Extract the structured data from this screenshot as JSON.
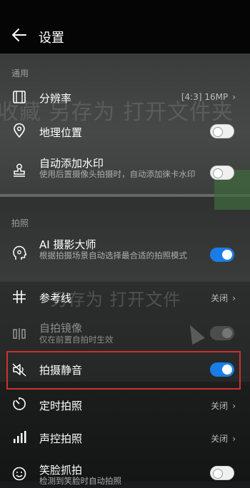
{
  "header": {
    "title": "设置",
    "back_icon": "back-arrow-icon"
  },
  "sections": {
    "general": "通用",
    "photo": "拍照"
  },
  "settings": {
    "resolution": {
      "label": "分辨率",
      "value": "[4:3] 16MP",
      "icon": "film-frame-icon"
    },
    "location": {
      "label": "地理位置",
      "state": "off",
      "icon": "location-pin-icon"
    },
    "watermark": {
      "label": "自动添加水印",
      "desc": "使用后置摄像头拍摄时，自动添加徕卡水印",
      "state": "off",
      "icon": "stamp-icon"
    },
    "ai_master": {
      "label": "AI 摄影大师",
      "desc": "根据拍摄场景自动选择最合适的拍照模式",
      "state": "on",
      "icon": "ai-head-icon"
    },
    "grid": {
      "label": "参考线",
      "value": "关闭",
      "icon": "grid-hash-icon"
    },
    "mirror": {
      "label": "自拍镜像",
      "desc": "仅在前置自拍时生效",
      "state": "off",
      "enabled": false,
      "icon": "mirror-icon"
    },
    "mute": {
      "label": "拍摄静音",
      "state": "on",
      "icon": "mute-speaker-icon"
    },
    "timer": {
      "label": "定时拍照",
      "value": "关闭",
      "icon": "timer-icon"
    },
    "voice": {
      "label": "声控拍照",
      "value": "关闭",
      "icon": "signal-bars-icon"
    },
    "smile": {
      "label": "笑脸抓拍",
      "desc": "检测到笑脸时自动拍照",
      "state": "off",
      "icon": "smile-icon"
    }
  },
  "chevron": "›",
  "colors": {
    "accent": "#1a7de6",
    "highlight_border": "#d0302d"
  }
}
